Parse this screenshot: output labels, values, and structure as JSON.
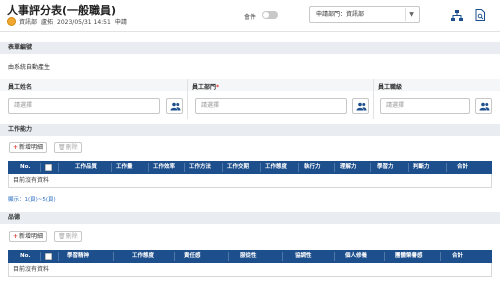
{
  "header": {
    "title": "人事評分表(一般職員)",
    "author_dept": "資訊部",
    "author_name": "盧拓",
    "datetime": "2023/05/31 14:51",
    "status": "申請",
    "toggle_label": "會件",
    "dept_select_value": "申請部門：資訊部"
  },
  "form_number": {
    "section_title": "表單編號",
    "value": "由系統自動產生"
  },
  "fields": {
    "name_label": "員工姓名",
    "name_placeholder": "請選擇",
    "dept_label": "員工部門",
    "dept_required_mark": "*",
    "dept_placeholder": "請選擇",
    "rank_label": "員工職級",
    "rank_placeholder": "請選擇"
  },
  "ability": {
    "section_title": "工作能力",
    "add_label": "新增明細",
    "delete_label": "刪除",
    "columns": [
      "No.",
      "工作品質",
      "工作量",
      "工作效率",
      "工作方法",
      "工作交期",
      "工作態度",
      "執行力",
      "理解力",
      "學習力",
      "判斷力",
      "合計"
    ],
    "empty_text": "目前沒有資料",
    "pager_text": "顯示：1(頁)~5(頁)"
  },
  "character": {
    "section_title": "品德",
    "add_label": "新增明細",
    "delete_label": "刪除",
    "columns": [
      "No.",
      "學習精神",
      "工作態度",
      "責任感",
      "服從性",
      "協調性",
      "個人修養",
      "團體榮譽感",
      "合計"
    ],
    "empty_text": "目前沒有資料"
  },
  "colors": {
    "table_header": "#1d4f8c",
    "section_header": "#e9edf2",
    "required": "#e23b3b",
    "link": "#2d6fc2"
  }
}
